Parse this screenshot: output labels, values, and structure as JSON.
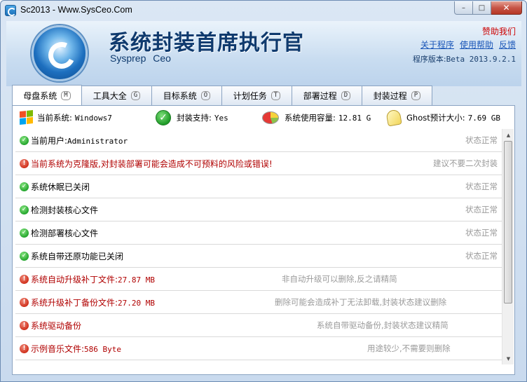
{
  "window": {
    "title": "Sc2013 - Www.SysCeo.Com",
    "controls": {
      "minimize": "–",
      "maximize": "□",
      "close": "✕"
    }
  },
  "header": {
    "app_title": "系统封装首席执行官",
    "app_subtitle": "Sysprep Ceo",
    "sponsor_link": "赞助我们",
    "links": [
      "关于程序",
      "使用帮助",
      "反馈"
    ],
    "version_label": "程序版本:",
    "version_value": "Beta 2013.9.2.1"
  },
  "tabs": [
    {
      "label": "母盘系统",
      "key": "M",
      "active": true
    },
    {
      "label": "工具大全",
      "key": "G",
      "active": false
    },
    {
      "label": "目标系统",
      "key": "O",
      "active": false
    },
    {
      "label": "计划任务",
      "key": "T",
      "active": false
    },
    {
      "label": "部署过程",
      "key": "D",
      "active": false
    },
    {
      "label": "封装过程",
      "key": "P",
      "active": false
    }
  ],
  "status": {
    "current_system_label": "当前系统:",
    "current_system_value": "Windows7",
    "sysprep_support_label": "封装支持:",
    "sysprep_support_value": "Yes",
    "disk_usage_label": "系统使用容量:",
    "disk_usage_value": "12.81 G",
    "ghost_size_label": "Ghost预计大小:",
    "ghost_size_value": "7.69 GB"
  },
  "checks": [
    {
      "status": "ok",
      "text": "当前用户:",
      "mono": "Administrator",
      "note": "状态正常",
      "note_align": "right"
    },
    {
      "status": "warn",
      "text": "当前系统为克隆版,对封装部署可能会造成不可预料的风险或错误!",
      "mono": "",
      "note": "建议不要二次封装",
      "note_align": "right",
      "red": true
    },
    {
      "status": "ok",
      "text": "系统休眠已关闭",
      "mono": "",
      "note": "状态正常",
      "note_align": "right"
    },
    {
      "status": "ok",
      "text": "检测封装核心文件",
      "mono": "",
      "note": "状态正常",
      "note_align": "right"
    },
    {
      "status": "ok",
      "text": "检测部署核心文件",
      "mono": "",
      "note": "状态正常",
      "note_align": "right"
    },
    {
      "status": "ok",
      "text": "系统自带还原功能已关闭",
      "mono": "",
      "note": "状态正常",
      "note_align": "right"
    },
    {
      "status": "warn",
      "text": "系统自动升级补丁文件:",
      "mono": "27.87 MB",
      "note": "非自动升级可以删除,反之请精简",
      "note_align": "mid1",
      "red": true
    },
    {
      "status": "warn",
      "text": "系统升级补丁备份文件:",
      "mono": "27.20 MB",
      "note": "删除可能会造成补丁无法卸载,封装状态建议删除",
      "note_align": "mid2",
      "red": true
    },
    {
      "status": "warn",
      "text": "系统驱动备份",
      "mono": "",
      "note": "系统自带驱动备份,封装状态建议精简",
      "note_align": "mid3",
      "red": true
    },
    {
      "status": "warn",
      "text": "示例音乐文件:",
      "mono": "586 Byte",
      "note": "用途较少,不需要则删除",
      "note_align": "mid4",
      "red": true
    }
  ],
  "icons": {
    "ok": "check-circle-icon",
    "warn": "exclamation-circle-icon"
  }
}
